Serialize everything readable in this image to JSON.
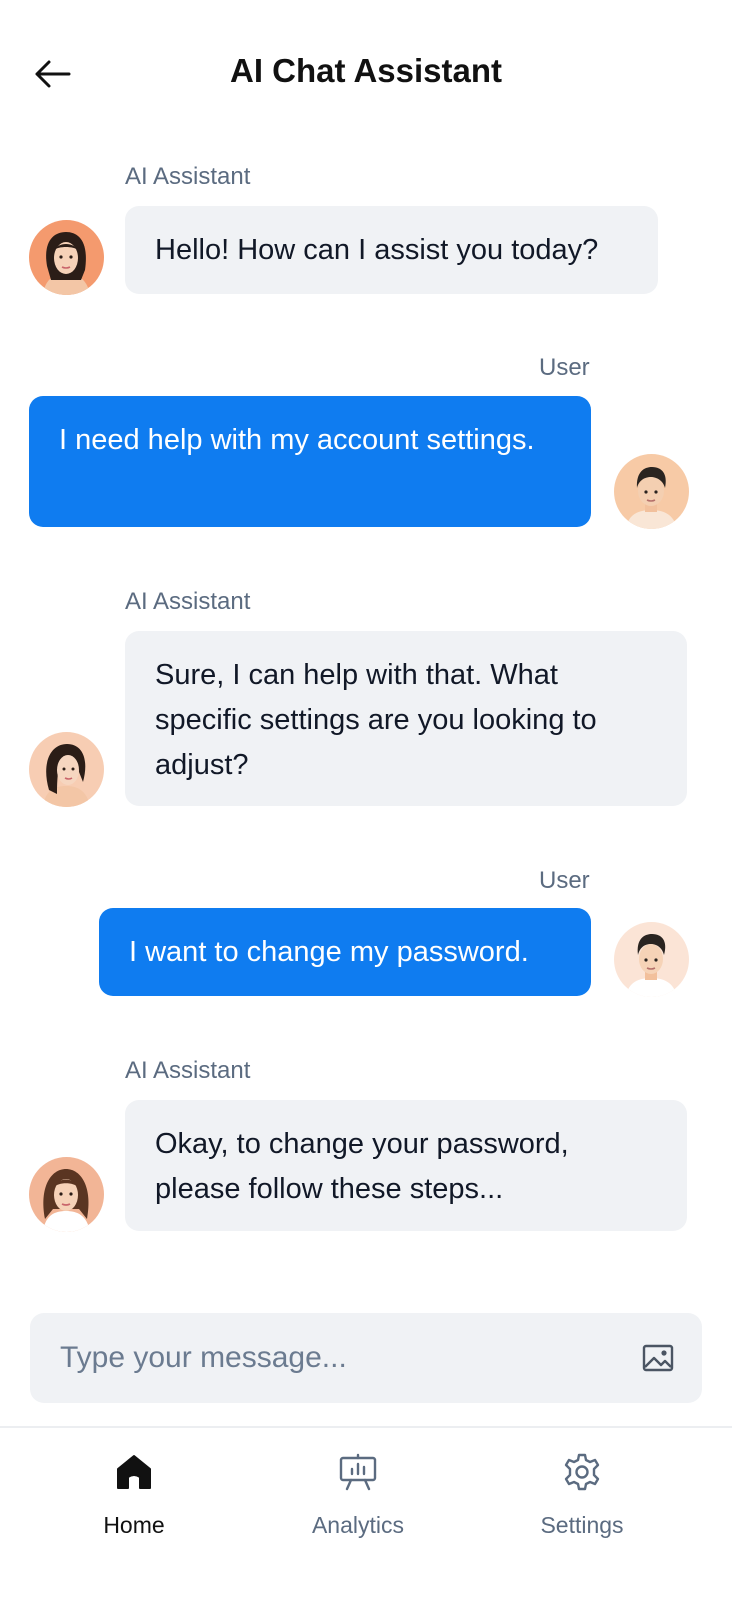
{
  "header": {
    "title": "AI Chat Assistant",
    "back_icon": "arrow-left-icon"
  },
  "messages": [
    {
      "role": "ai",
      "sender": "AI Assistant",
      "text": "Hello! How can I assist you today?"
    },
    {
      "role": "user",
      "sender": "User",
      "text": "I need help with my account settings."
    },
    {
      "role": "ai",
      "sender": "AI Assistant",
      "text": "Sure, I can help with that. What specific settings are you looking to adjust?"
    },
    {
      "role": "user",
      "sender": "User",
      "text": "I want to change my password."
    },
    {
      "role": "ai",
      "sender": "AI Assistant",
      "text": "Okay, to change your password, please follow these steps..."
    }
  ],
  "composer": {
    "placeholder": "Type your message...",
    "value": "",
    "attach_icon": "image-icon"
  },
  "nav": {
    "items": [
      {
        "label": "Home",
        "icon": "home-icon",
        "active": true
      },
      {
        "label": "Analytics",
        "icon": "analytics-icon",
        "active": false
      },
      {
        "label": "Settings",
        "icon": "gear-icon",
        "active": false
      }
    ]
  },
  "colors": {
    "accent": "#0f7cf0",
    "ai_bubble": "#f0f2f5",
    "muted_text": "#5b6b80"
  }
}
